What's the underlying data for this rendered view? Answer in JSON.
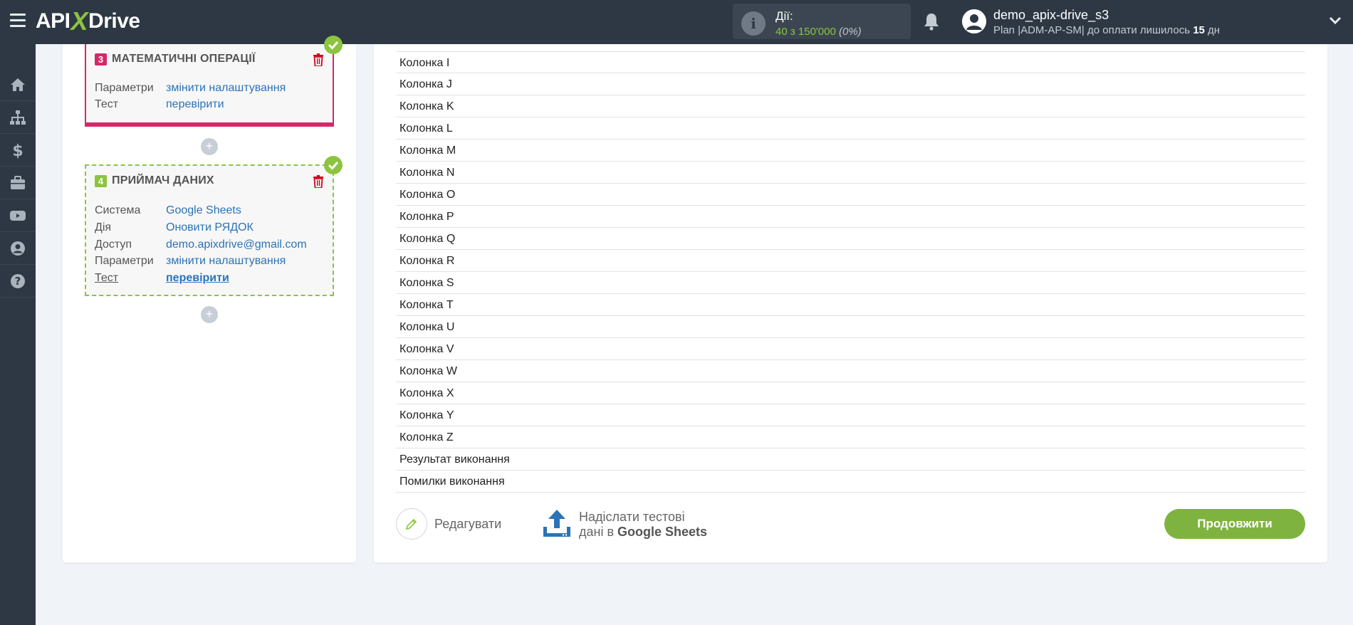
{
  "header": {
    "logo_api": "API",
    "logo_x": "X",
    "logo_drive": "Drive",
    "actions_label": "Дії:",
    "actions_value": "40 з 150'000",
    "actions_pct": "(0%)",
    "user_name": "demo_apix-drive_s3",
    "user_plan_prefix": "Plan |ADM-AP-SM| до оплати лишилось ",
    "user_plan_days": "15",
    "user_plan_suffix": " дн"
  },
  "sidebar": {
    "items": [
      {
        "icon": "home-icon"
      },
      {
        "icon": "sitemap-icon"
      },
      {
        "icon": "dollar-icon"
      },
      {
        "icon": "briefcase-icon"
      },
      {
        "icon": "youtube-icon"
      },
      {
        "icon": "user-circle-icon"
      },
      {
        "icon": "question-icon"
      }
    ]
  },
  "steps": {
    "step3": {
      "number": "3",
      "title": "МАТЕМАТИЧНІ ОПЕРАЦІЇ",
      "color": "#d6276a",
      "rows": [
        {
          "key": "Параметри",
          "value": "змінити налаштування"
        },
        {
          "key": "Тест",
          "value": "перевірити"
        }
      ]
    },
    "step4": {
      "number": "4",
      "title": "ПРИЙМАЧ ДАНИХ",
      "color": "#8cc43f",
      "rows": [
        {
          "key": "Система",
          "value": "Google Sheets"
        },
        {
          "key": "Дія",
          "value": "Оновити РЯДОК"
        },
        {
          "key": "Доступ",
          "value": "demo.apixdrive@gmail.com"
        },
        {
          "key": "Параметри",
          "value": "змінити налаштування"
        },
        {
          "key": "Тест",
          "value": "перевірити"
        }
      ]
    },
    "plus": "+"
  },
  "columns": [
    "Колонка I",
    "Колонка J",
    "Колонка K",
    "Колонка L",
    "Колонка M",
    "Колонка N",
    "Колонка O",
    "Колонка P",
    "Колонка Q",
    "Колонка R",
    "Колонка S",
    "Колонка T",
    "Колонка U",
    "Колонка V",
    "Колонка W",
    "Колонка X",
    "Колонка Y",
    "Колонка Z",
    "Результат виконання",
    "Помилки виконання"
  ],
  "footer": {
    "edit_label": "Редагувати",
    "send_line1": "Надіслати тестові",
    "send_line2_prefix": "дані в ",
    "send_line2_bold": "Google Sheets",
    "continue_label": "Продовжити"
  }
}
